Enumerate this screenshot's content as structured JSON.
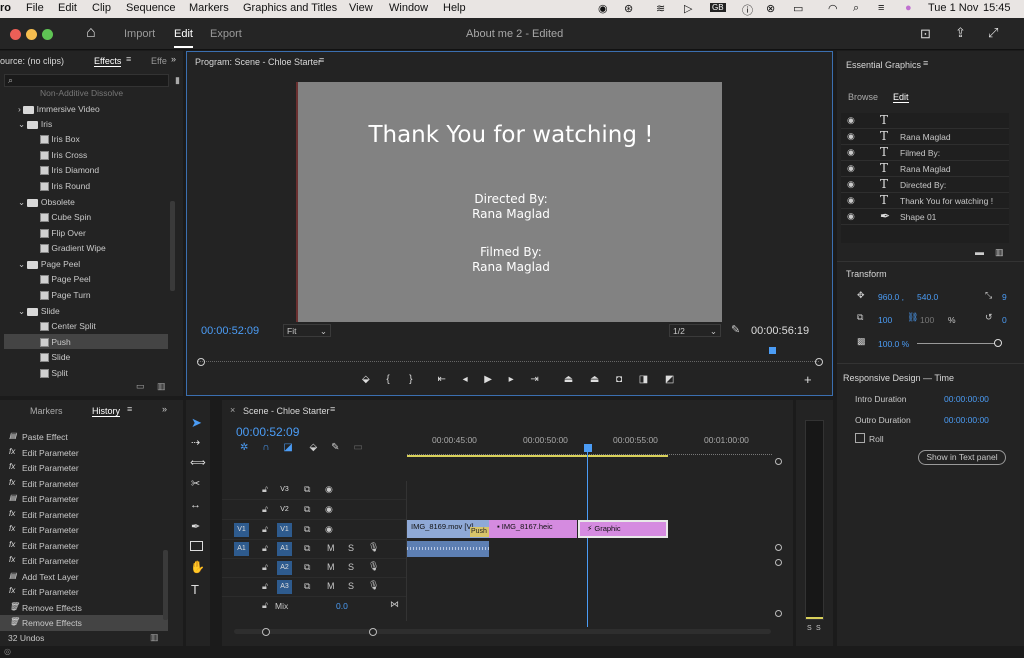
{
  "menubar": {
    "app": "ro",
    "items": [
      "File",
      "Edit",
      "Clip",
      "Sequence",
      "Markers",
      "Graphics and Titles",
      "View",
      "Window",
      "Help"
    ],
    "date": "Tue 1 Nov",
    "time": "15:45",
    "kb": "GB"
  },
  "titlebar": {
    "tabs": [
      "Import",
      "Edit",
      "Export"
    ],
    "project": "About me 2",
    "edited": "- Edited"
  },
  "source": {
    "label": "ource: (no clips)",
    "tab_effects": "Effects",
    "tab_other": "Effe"
  },
  "effects": {
    "top_partial": "Non-Additive Dissolve",
    "folder_immersive": "Immersive Video",
    "folder_iris": "Iris",
    "iris": [
      "Iris Box",
      "Iris Cross",
      "Iris Diamond",
      "Iris Round"
    ],
    "folder_obsolete": "Obsolete",
    "obsolete": [
      "Cube Spin",
      "Flip Over",
      "Gradient Wipe"
    ],
    "folder_pagepeel": "Page Peel",
    "pagepeel": [
      "Page Peel",
      "Page Turn"
    ],
    "folder_slide": "Slide",
    "slide": [
      "Center Split",
      "Push",
      "Slide",
      "Split"
    ]
  },
  "history": {
    "tab_markers": "Markers",
    "tab_history": "History",
    "items": [
      "Paste Effect",
      "Edit Parameter",
      "Edit Parameter",
      "Edit Parameter",
      "Edit Parameter",
      "Edit Parameter",
      "Edit Parameter",
      "Edit Parameter",
      "Edit Parameter",
      "Add Text Layer",
      "Edit Parameter",
      "Remove Effects",
      "Remove Effects"
    ],
    "count": "32 Undos"
  },
  "program": {
    "title": "Program: Scene - Chloe Starter",
    "frame_title": "Thank You for watching !",
    "directed_label": "Directed By:",
    "directed_name": "Rana Maglad",
    "filmed_label": "Filmed By:",
    "filmed_name": "Rana Maglad",
    "timecode": "00:00:52:09",
    "fit": "Fit",
    "quality": "1/2",
    "duration": "00:00:56:19"
  },
  "timeline": {
    "title": "Scene - Chloe Starter",
    "timecode": "00:00:52:09",
    "ruler": [
      "00:00:45:00",
      "00:00:50:00",
      "00:00:55:00",
      "00:01:00:00"
    ],
    "video_tracks": [
      "V3",
      "V2",
      "V1"
    ],
    "audio_tracks": [
      "A1",
      "A2",
      "A3"
    ],
    "src_v": "V1",
    "src_a": "A1",
    "mix_label": "Mix",
    "mix_value": "0.0",
    "clips": {
      "clip1": "IMG_8169.mov [V]",
      "transition": "Push",
      "clip2": "IMG_8167.heic",
      "clip3": "Graphic"
    },
    "m": "M",
    "s": "S"
  },
  "essential": {
    "title": "Essential Graphics",
    "tab_browse": "Browse",
    "tab_edit": "Edit",
    "layers": [
      "",
      "Rana Maglad",
      "Filmed By:",
      "Rana Maglad",
      "Directed By:",
      "Thank You for watching !",
      "Shape 01"
    ],
    "transform_label": "Transform",
    "pos_x": "960.0 ,",
    "pos_y": "540.0",
    "rotation": "9",
    "scale": "100",
    "scale_h": "100",
    "pct": "%",
    "rot2": "0",
    "opacity": "100.0 %",
    "responsive_label": "Responsive Design — Time",
    "intro_label": "Intro Duration",
    "intro_value": "00:00:00:00",
    "outro_label": "Outro Duration",
    "outro_value": "00:00:00:00",
    "roll_label": "Roll",
    "show_text_btn": "Show in Text panel"
  },
  "meter": {
    "s1": "S",
    "s2": "S"
  },
  "colors": {
    "accent": "#4b9cf5",
    "clip_blue": "#8fa9d6",
    "clip_pink": "#d58be0",
    "clip_yellow": "#d8c56a"
  }
}
